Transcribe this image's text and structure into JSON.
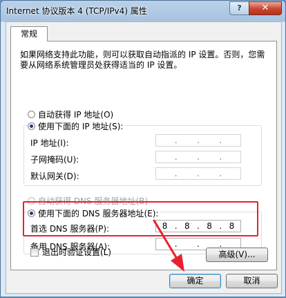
{
  "window": {
    "title": "Internet 协议版本 4 (TCP/IPv4) 属性",
    "help_label": "?",
    "close_label": "✕"
  },
  "tabs": [
    {
      "label": "常规"
    }
  ],
  "description": "如果网络支持此功能，则可以获取自动指派的 IP 设置。否则，您需要从网络系统管理员处获得适当的 IP 设置。",
  "ip_section": {
    "auto_label": "自动获得 IP 地址(O)",
    "manual_label": "使用下面的 IP 地址(S):",
    "manual_selected": true,
    "fields": [
      {
        "label": "IP 地址(I):",
        "octets": [
          "",
          "",
          "",
          ""
        ]
      },
      {
        "label": "子网掩码(U):",
        "octets": [
          "",
          "",
          "",
          ""
        ]
      },
      {
        "label": "默认网关(D):",
        "octets": [
          "",
          "",
          "",
          ""
        ]
      }
    ]
  },
  "dns_section": {
    "auto_label": "自动获得 DNS 服务器地址(B)",
    "manual_label": "使用下面的 DNS 服务器地址(E):",
    "manual_selected": true,
    "fields": [
      {
        "label": "首选 DNS 服务器(P):",
        "octets": [
          "8",
          "8",
          "8",
          "8"
        ]
      },
      {
        "label": "备用 DNS 服务器(A):",
        "octets": [
          "",
          "",
          "",
          ""
        ]
      }
    ]
  },
  "validate_label": "退出时验证设置(L)",
  "advanced_label": "高级(V)...",
  "ok_label": "确定",
  "cancel_label": "取消",
  "colors": {
    "highlight": "#e8202e",
    "title_bar": "#b9d1ea"
  }
}
